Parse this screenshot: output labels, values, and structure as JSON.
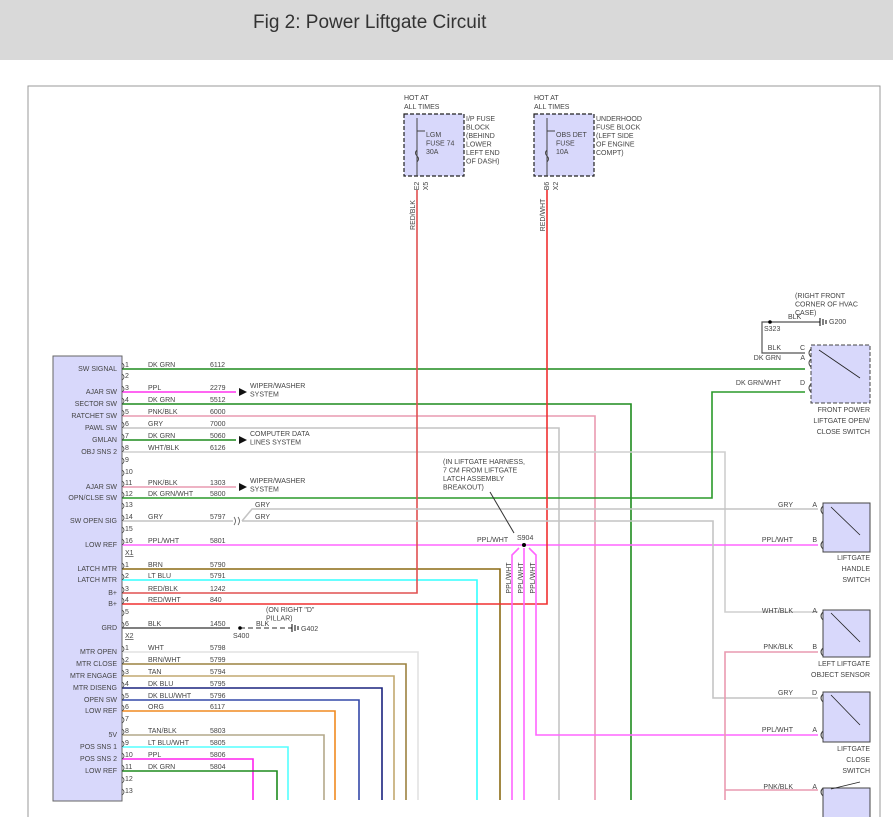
{
  "title": "Fig 2: Power Liftgate Circuit",
  "fuses": [
    {
      "hot": [
        "HOT AT",
        "ALL TIMES"
      ],
      "name": [
        "LGM",
        "FUSE 74",
        "30A"
      ],
      "location": [
        "I/P FUSE",
        "BLOCK",
        "(BEHIND",
        "LOWER",
        "LEFT END",
        "OF DASH)"
      ],
      "pins": [
        "E2",
        "X5"
      ],
      "wire": "RED/BLK"
    },
    {
      "hot": [
        "HOT AT",
        "ALL TIMES"
      ],
      "name": [
        "OBS DET",
        "FUSE",
        "10A"
      ],
      "location": [
        "UNDERHOOD",
        "FUSE BLOCK",
        "(LEFT SIDE",
        "OF ENGINE",
        "COMPT)"
      ],
      "pins": [
        "B6",
        "X2"
      ],
      "wire": "RED/WHT"
    }
  ],
  "connectors": [
    {
      "label": "",
      "pins": [
        {
          "pin": "1",
          "func": "SW SIGNAL",
          "wire": "DK GRN",
          "circuit": "6112",
          "color": "#1e8c1e"
        },
        {
          "pin": "2",
          "func": "",
          "wire": "",
          "circuit": "",
          "color": ""
        },
        {
          "pin": "3",
          "func": "AJAR SW",
          "wire": "PPL",
          "circuit": "2279",
          "color": "#ff33ee"
        },
        {
          "pin": "4",
          "func": "SECTOR SW",
          "wire": "DK GRN",
          "circuit": "5512",
          "color": "#1e8c1e"
        },
        {
          "pin": "5",
          "func": "RATCHET SW",
          "wire": "PNK/BLK",
          "circuit": "6000",
          "color": "#e99ab0"
        },
        {
          "pin": "6",
          "func": "PAWL SW",
          "wire": "GRY",
          "circuit": "7000",
          "color": "#c4c4c4"
        },
        {
          "pin": "7",
          "func": "GMLAN",
          "wire": "DK GRN",
          "circuit": "5060",
          "color": "#1e8c1e"
        },
        {
          "pin": "8",
          "func": "OBJ SNS 2",
          "wire": "WHT/BLK",
          "circuit": "6126",
          "color": "#cfcfcf"
        },
        {
          "pin": "9",
          "func": "",
          "wire": "",
          "circuit": "",
          "color": ""
        },
        {
          "pin": "10",
          "func": "",
          "wire": "",
          "circuit": "",
          "color": ""
        },
        {
          "pin": "11",
          "func": "AJAR SW",
          "wire": "PNK/BLK",
          "circuit": "1303",
          "color": "#e99ab0"
        },
        {
          "pin": "12",
          "func": "OPN/CLSE SW",
          "wire": "DK GRN/WHT",
          "circuit": "5800",
          "color": "#2a9a2a"
        },
        {
          "pin": "13",
          "func": "",
          "wire": "",
          "circuit": "",
          "color": ""
        },
        {
          "pin": "14",
          "func": "SW OPEN SIG",
          "wire": "GRY",
          "circuit": "5797",
          "color": "#c4c4c4"
        },
        {
          "pin": "15",
          "func": "",
          "wire": "",
          "circuit": "",
          "color": ""
        },
        {
          "pin": "16",
          "func": "LOW REF",
          "wire": "PPL/WHT",
          "circuit": "5801",
          "color": "#ff66ff"
        }
      ]
    },
    {
      "label": "X1",
      "pins": [
        {
          "pin": "1",
          "func": "LATCH MTR",
          "wire": "BRN",
          "circuit": "5790",
          "color": "#8b6a14"
        },
        {
          "pin": "2",
          "func": "LATCH MTR",
          "wire": "LT BLU",
          "circuit": "5791",
          "color": "#33ffff"
        },
        {
          "pin": "3",
          "func": "B+",
          "wire": "RED/BLK",
          "circuit": "1242",
          "color": "#e05050"
        },
        {
          "pin": "4",
          "func": "B+",
          "wire": "RED/WHT",
          "circuit": "840",
          "color": "#f03030"
        },
        {
          "pin": "5",
          "func": "",
          "wire": "",
          "circuit": "",
          "color": ""
        },
        {
          "pin": "6",
          "func": "GRD",
          "wire": "BLK",
          "circuit": "1450",
          "color": "#555555"
        }
      ]
    },
    {
      "label": "X2",
      "pins": [
        {
          "pin": "1",
          "func": "MTR OPEN",
          "wire": "WHT",
          "circuit": "5798",
          "color": "#e2e2e2"
        },
        {
          "pin": "2",
          "func": "MTR CLOSE",
          "wire": "BRN/WHT",
          "circuit": "5799",
          "color": "#9c8240"
        },
        {
          "pin": "3",
          "func": "MTR ENGAGE",
          "wire": "TAN",
          "circuit": "5794",
          "color": "#c2a870"
        },
        {
          "pin": "4",
          "func": "MTR DISENG",
          "wire": "DK BLU",
          "circuit": "5795",
          "color": "#1a237e"
        },
        {
          "pin": "5",
          "func": "OPEN SW",
          "wire": "DK BLU/WHT",
          "circuit": "5796",
          "color": "#3448a8"
        },
        {
          "pin": "6",
          "func": "LOW REF",
          "wire": "ORG",
          "circuit": "6117",
          "color": "#f08a20"
        },
        {
          "pin": "7",
          "func": "",
          "wire": "",
          "circuit": "",
          "color": ""
        },
        {
          "pin": "8",
          "func": "5V",
          "wire": "TAN/BLK",
          "circuit": "5803",
          "color": "#b4a88a"
        },
        {
          "pin": "9",
          "func": "POS SNS 1",
          "wire": "LT BLU/WHT",
          "circuit": "5805",
          "color": "#55ffff"
        },
        {
          "pin": "10",
          "func": "POS SNS 2",
          "wire": "PPL",
          "circuit": "5806",
          "color": "#ff22ee"
        },
        {
          "pin": "11",
          "func": "LOW REF",
          "wire": "DK GRN",
          "circuit": "5804",
          "color": "#1e8c1e"
        },
        {
          "pin": "12",
          "func": "",
          "wire": "",
          "circuit": "",
          "color": ""
        },
        {
          "pin": "13",
          "func": "",
          "wire": "",
          "circuit": "",
          "color": ""
        }
      ]
    }
  ],
  "destinations": {
    "wiper1": [
      "WIPER/WASHER",
      "SYSTEM"
    ],
    "data": [
      "COMPUTER DATA",
      "LINES SYSTEM"
    ],
    "wiper2": [
      "WIPER/WASHER",
      "SYSTEM"
    ]
  },
  "gry_branch": [
    "GRY",
    "GRY"
  ],
  "splice_s904": {
    "name": "S904",
    "note": [
      "(IN LIFTGATE HARNESS,",
      "7 CM FROM LIFTGATE",
      "LATCH ASSEMBLY",
      "BREAKOUT)"
    ],
    "wire": "PPL/WHT",
    "branches": [
      "PPL/WHT",
      "PPL/WHT",
      "PPL/WHT"
    ]
  },
  "ground_g402": {
    "splice": "S400",
    "wire": "BLK",
    "name": "G402",
    "note": [
      "(ON RIGHT \"D\"",
      "PILLAR)"
    ]
  },
  "ground_g200": {
    "splice": "S323",
    "wire": "BLK",
    "name": "G200",
    "note": [
      "(RIGHT FRONT",
      "CORNER OF HVAC",
      "CASE)"
    ]
  },
  "components": {
    "front_switch": {
      "name": [
        "FRONT POWER",
        "LIFTGATE OPEN/",
        "CLOSE SWITCH"
      ],
      "pins": [
        {
          "pin": "C",
          "wire": "BLK"
        },
        {
          "pin": "A",
          "wire": "DK GRN"
        },
        {
          "pin": "D",
          "wire": "DK GRN/WHT"
        }
      ]
    },
    "handle_switch": {
      "name": [
        "LIFTGATE",
        "HANDLE",
        "SWITCH"
      ],
      "pins": [
        {
          "pin": "A",
          "wire": "GRY"
        },
        {
          "pin": "B",
          "wire": "PPL/WHT"
        }
      ]
    },
    "object_sensor": {
      "name": [
        "LEFT LIFTGATE",
        "OBJECT SENSOR"
      ],
      "pins": [
        {
          "pin": "A",
          "wire": "WHT/BLK"
        },
        {
          "pin": "B",
          "wire": "PNK/BLK"
        }
      ]
    },
    "close_switch": {
      "name": [
        "LIFTGATE",
        "CLOSE",
        "SWITCH"
      ],
      "pins": [
        {
          "pin": "D",
          "wire": "GRY"
        },
        {
          "pin": "A",
          "wire": "PPL/WHT"
        }
      ]
    },
    "bottom_component": {
      "pins": [
        {
          "pin": "A",
          "wire": "PNK/BLK"
        }
      ]
    }
  }
}
